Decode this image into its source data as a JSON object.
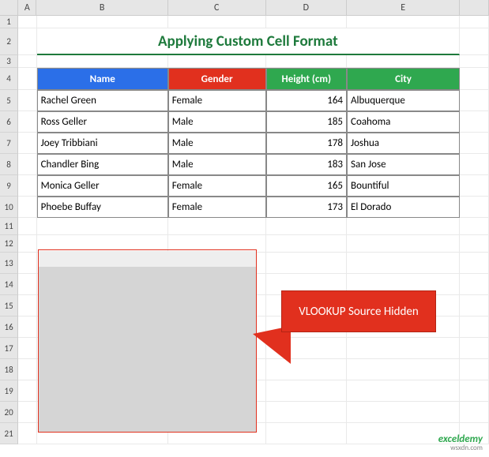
{
  "columns": {
    "A": "A",
    "B": "B",
    "C": "C",
    "D": "D",
    "E": "E"
  },
  "rownums": [
    "1",
    "2",
    "3",
    "4",
    "5",
    "6",
    "7",
    "8",
    "9",
    "10",
    "11",
    "12",
    "13",
    "14",
    "15",
    "16",
    "17",
    "18",
    "19",
    "20",
    "21"
  ],
  "title": "Applying Custom Cell Format",
  "headers": {
    "name": "Name",
    "gender": "Gender",
    "height": "Height (cm)",
    "city": "City"
  },
  "rows": [
    {
      "name": "Rachel Green",
      "gender": "Female",
      "height": "164",
      "city": "Albuquerque"
    },
    {
      "name": "Ross Geller",
      "gender": "Male",
      "height": "185",
      "city": "Coahoma"
    },
    {
      "name": "Joey Tribbiani",
      "gender": "Male",
      "height": "178",
      "city": "Joshua"
    },
    {
      "name": "Chandler Bing",
      "gender": "Male",
      "height": "183",
      "city": "San Jose"
    },
    {
      "name": "Monica Geller",
      "gender": "Female",
      "height": "165",
      "city": "Bountiful"
    },
    {
      "name": "Phoebe Buffay",
      "gender": "Female",
      "height": "173",
      "city": "El Dorado"
    }
  ],
  "callout": "VLOOKUP Source Hidden",
  "watermark": {
    "brand": "exceldemy",
    "sub": "wsxdn.com"
  }
}
